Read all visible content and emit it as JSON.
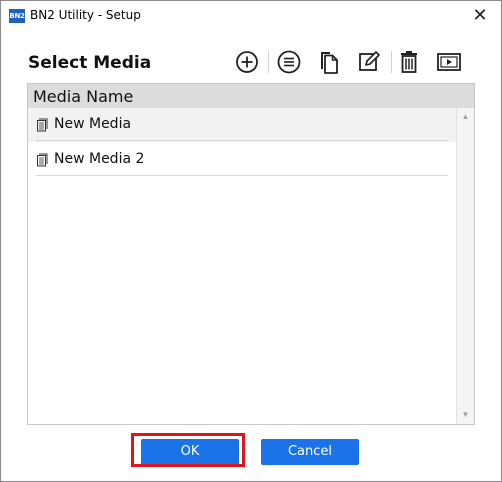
{
  "window": {
    "app_icon_text": "BN2",
    "title": "BN2 Utility - Setup",
    "close_glyph": "✕"
  },
  "header": {
    "label": "Select Media",
    "toolbar": [
      {
        "icon": "add-circle-icon",
        "tooltip": "Add"
      },
      {
        "icon": "list-circle-icon",
        "tooltip": "Details"
      },
      {
        "icon": "copy-icon",
        "tooltip": "Copy"
      },
      {
        "icon": "edit-icon",
        "tooltip": "Edit"
      },
      {
        "icon": "trash-icon",
        "tooltip": "Delete"
      },
      {
        "icon": "preview-icon",
        "tooltip": "Preview"
      }
    ]
  },
  "media_list": {
    "column_header": "Media Name",
    "rows": [
      {
        "label": "New Media",
        "selected": true
      },
      {
        "label": "New Media 2",
        "selected": false
      }
    ]
  },
  "footer": {
    "ok_label": "OK",
    "cancel_label": "Cancel",
    "highlight_color": "#e0151b",
    "button_color": "#1a73e8"
  }
}
